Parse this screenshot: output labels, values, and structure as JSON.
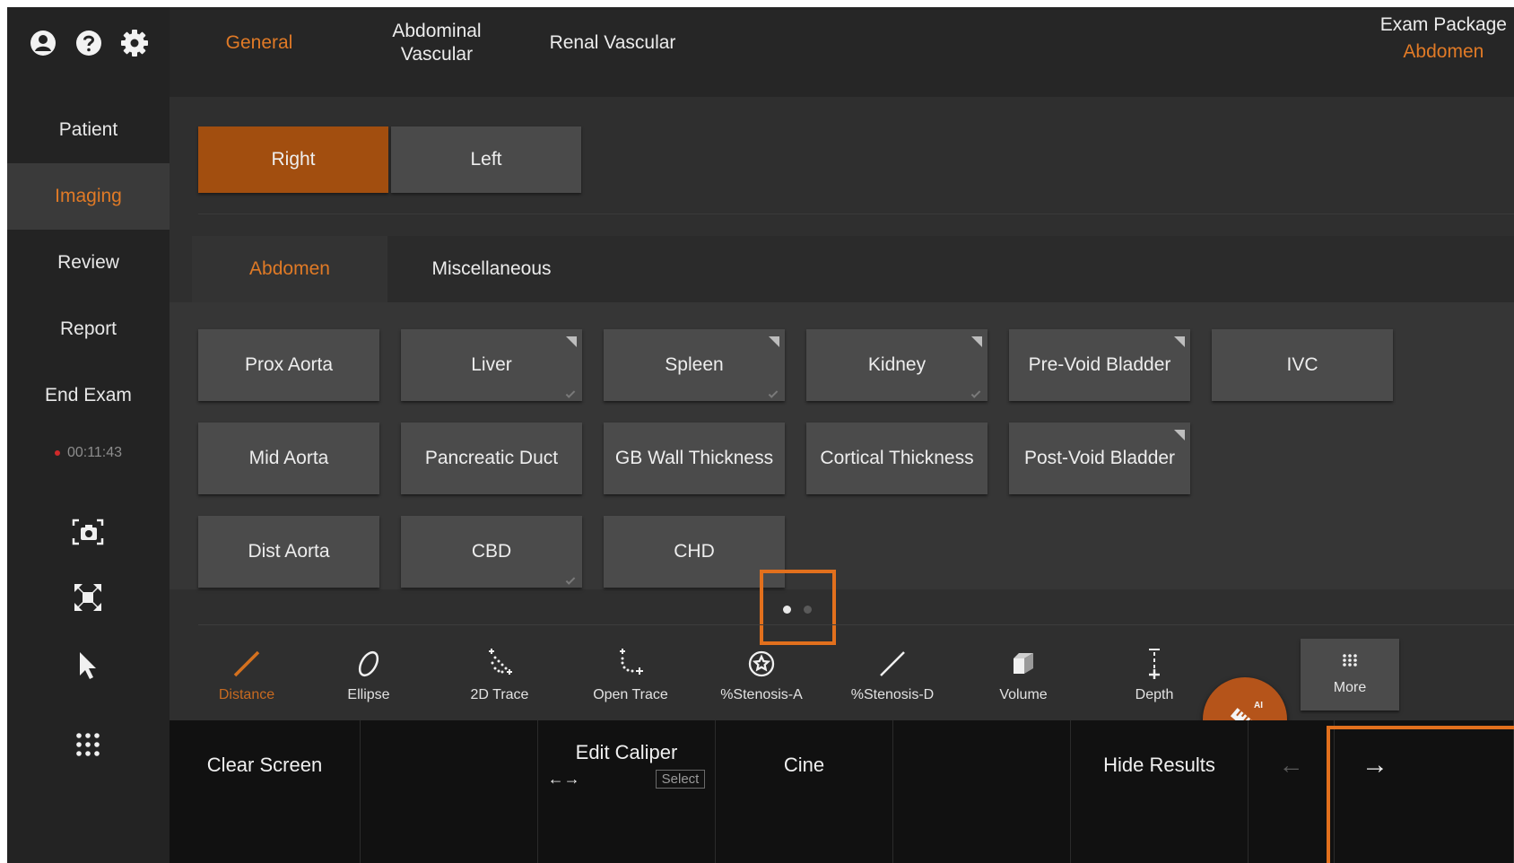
{
  "sidebar": {
    "top_icons": [
      "user-icon",
      "help-icon",
      "gear-icon"
    ],
    "items": [
      {
        "label": "Patient",
        "active": false
      },
      {
        "label": "Imaging",
        "active": true
      },
      {
        "label": "Review",
        "active": false
      },
      {
        "label": "Report",
        "active": false
      },
      {
        "label": "End Exam",
        "active": false
      }
    ],
    "timer": "00:11:43",
    "tool_icons": [
      "camera-capture-icon",
      "fullscreen-icon",
      "pointer-icon",
      "apps-grid-icon"
    ]
  },
  "header": {
    "tabs": [
      {
        "label": "General",
        "active": true
      },
      {
        "label": "Abdominal Vascular",
        "active": false
      },
      {
        "label": "Renal Vascular",
        "active": false
      }
    ],
    "exam_package_label": "Exam Package",
    "exam_package_value": "Abdomen"
  },
  "side_selector": {
    "right": "Right",
    "left": "Left",
    "selected": "Right"
  },
  "categories": [
    {
      "label": "Abdomen",
      "active": true
    },
    {
      "label": "Miscellaneous",
      "active": false
    }
  ],
  "measurements": [
    {
      "label": "Prox Aorta",
      "submenu": false,
      "done": false
    },
    {
      "label": "Liver",
      "submenu": true,
      "done": true
    },
    {
      "label": "Spleen",
      "submenu": true,
      "done": true
    },
    {
      "label": "Kidney",
      "submenu": true,
      "done": true
    },
    {
      "label": "Pre-Void Bladder",
      "submenu": true,
      "done": false
    },
    {
      "label": "IVC",
      "submenu": false,
      "done": false
    },
    {
      "label": "Mid Aorta",
      "submenu": false,
      "done": false
    },
    {
      "label": "Pancreatic Duct",
      "submenu": false,
      "done": false
    },
    {
      "label": "GB Wall Thickness",
      "submenu": false,
      "done": false
    },
    {
      "label": "Cortical Thickness",
      "submenu": false,
      "done": false
    },
    {
      "label": "Post-Void Bladder",
      "submenu": true,
      "done": false
    },
    {
      "label": "Dist Aorta",
      "submenu": false,
      "done": false
    },
    {
      "label": "CBD",
      "submenu": false,
      "done": true
    },
    {
      "label": "CHD",
      "submenu": false,
      "done": false
    }
  ],
  "pager": {
    "pages": 2,
    "current": 1
  },
  "tools": [
    {
      "label": "Distance",
      "icon": "distance-line-icon",
      "active": true
    },
    {
      "label": "Ellipse",
      "icon": "ellipse-icon",
      "active": false
    },
    {
      "label": "2D Trace",
      "icon": "2d-trace-icon",
      "active": false
    },
    {
      "label": "Open Trace",
      "icon": "open-trace-icon",
      "active": false
    },
    {
      "label": "%Stenosis-A",
      "icon": "stenosis-area-icon",
      "active": false
    },
    {
      "label": "%Stenosis-D",
      "icon": "stenosis-diameter-icon",
      "active": false
    },
    {
      "label": "Volume",
      "icon": "volume-cube-icon",
      "active": false
    },
    {
      "label": "Depth",
      "icon": "depth-icon",
      "active": false
    }
  ],
  "more_label": "More",
  "ai_badge": "AI",
  "bottom_bar": {
    "clear_screen": "Clear Screen",
    "edit_caliper": "Edit Caliper",
    "edit_caliper_arrows": "←→",
    "edit_caliper_select": "Select",
    "cine": "Cine",
    "hide_results": "Hide Results",
    "prev_arrow": "←",
    "next_arrow": "→"
  },
  "colors": {
    "accent": "#e07a26",
    "selected_button": "#a24e0f",
    "highlight_box": "#e2701d",
    "background": "#2f2f2f",
    "button": "#4b4b4b"
  }
}
